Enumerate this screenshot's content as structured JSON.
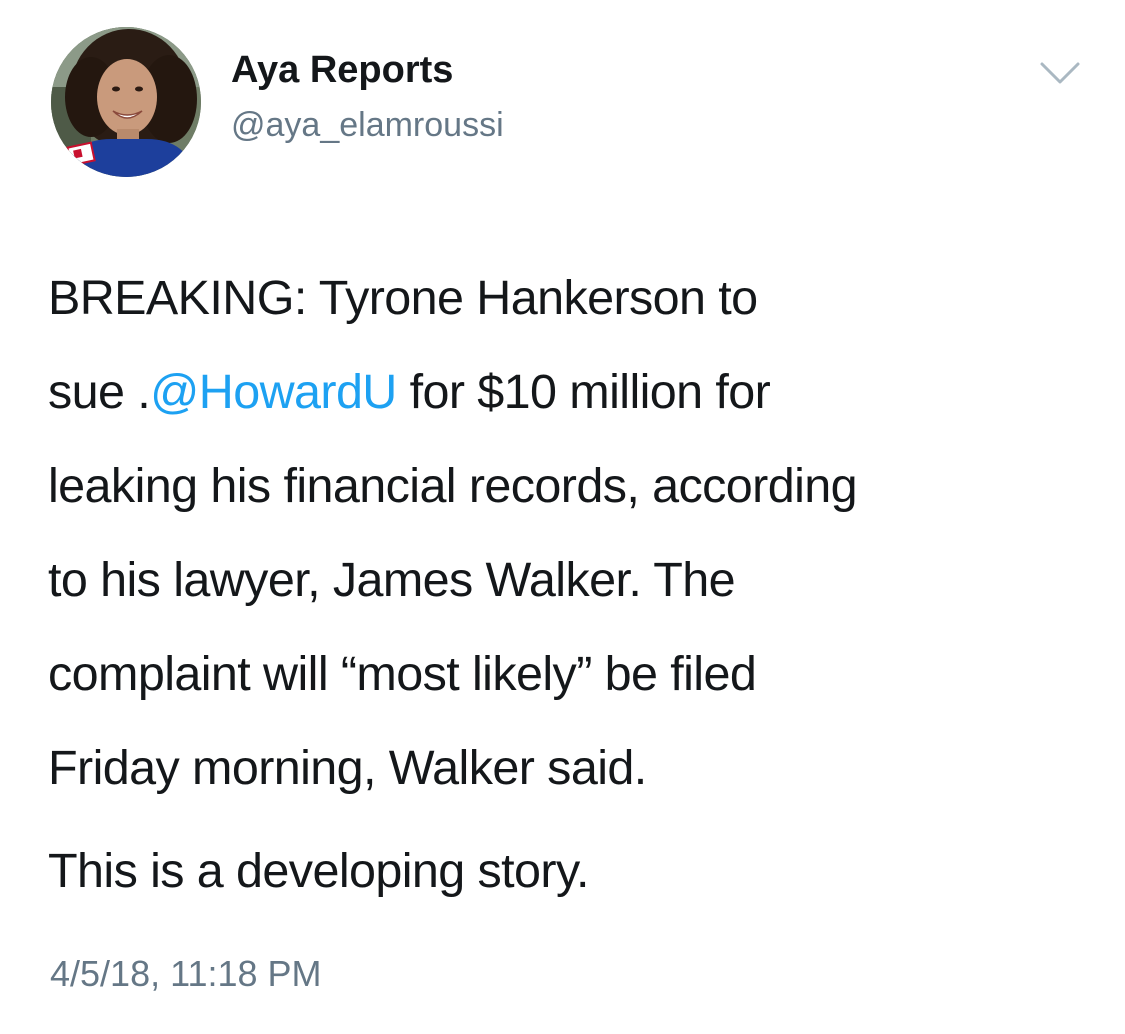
{
  "tweet": {
    "author": {
      "display_name": "Aya Reports",
      "handle": "@aya_elamroussi"
    },
    "menu_icon": "chevron-down-icon",
    "body": {
      "line1": "BREAKING: Tyrone Hankerson to",
      "line2_prefix": "sue .",
      "line2_mention": "@HowardU",
      "line2_suffix": " for $10 million for",
      "line3": "leaking his financial records, according",
      "line4": "to his lawyer, James Walker. The",
      "line5": "complaint will “most likely” be filed",
      "line6": "Friday morning, Walker said.",
      "paragraph2": "This is a developing story."
    },
    "timestamp": "4/5/18, 11:18 PM"
  },
  "colors": {
    "text": "#14171a",
    "secondary_text": "#657786",
    "link": "#1da1f2"
  }
}
